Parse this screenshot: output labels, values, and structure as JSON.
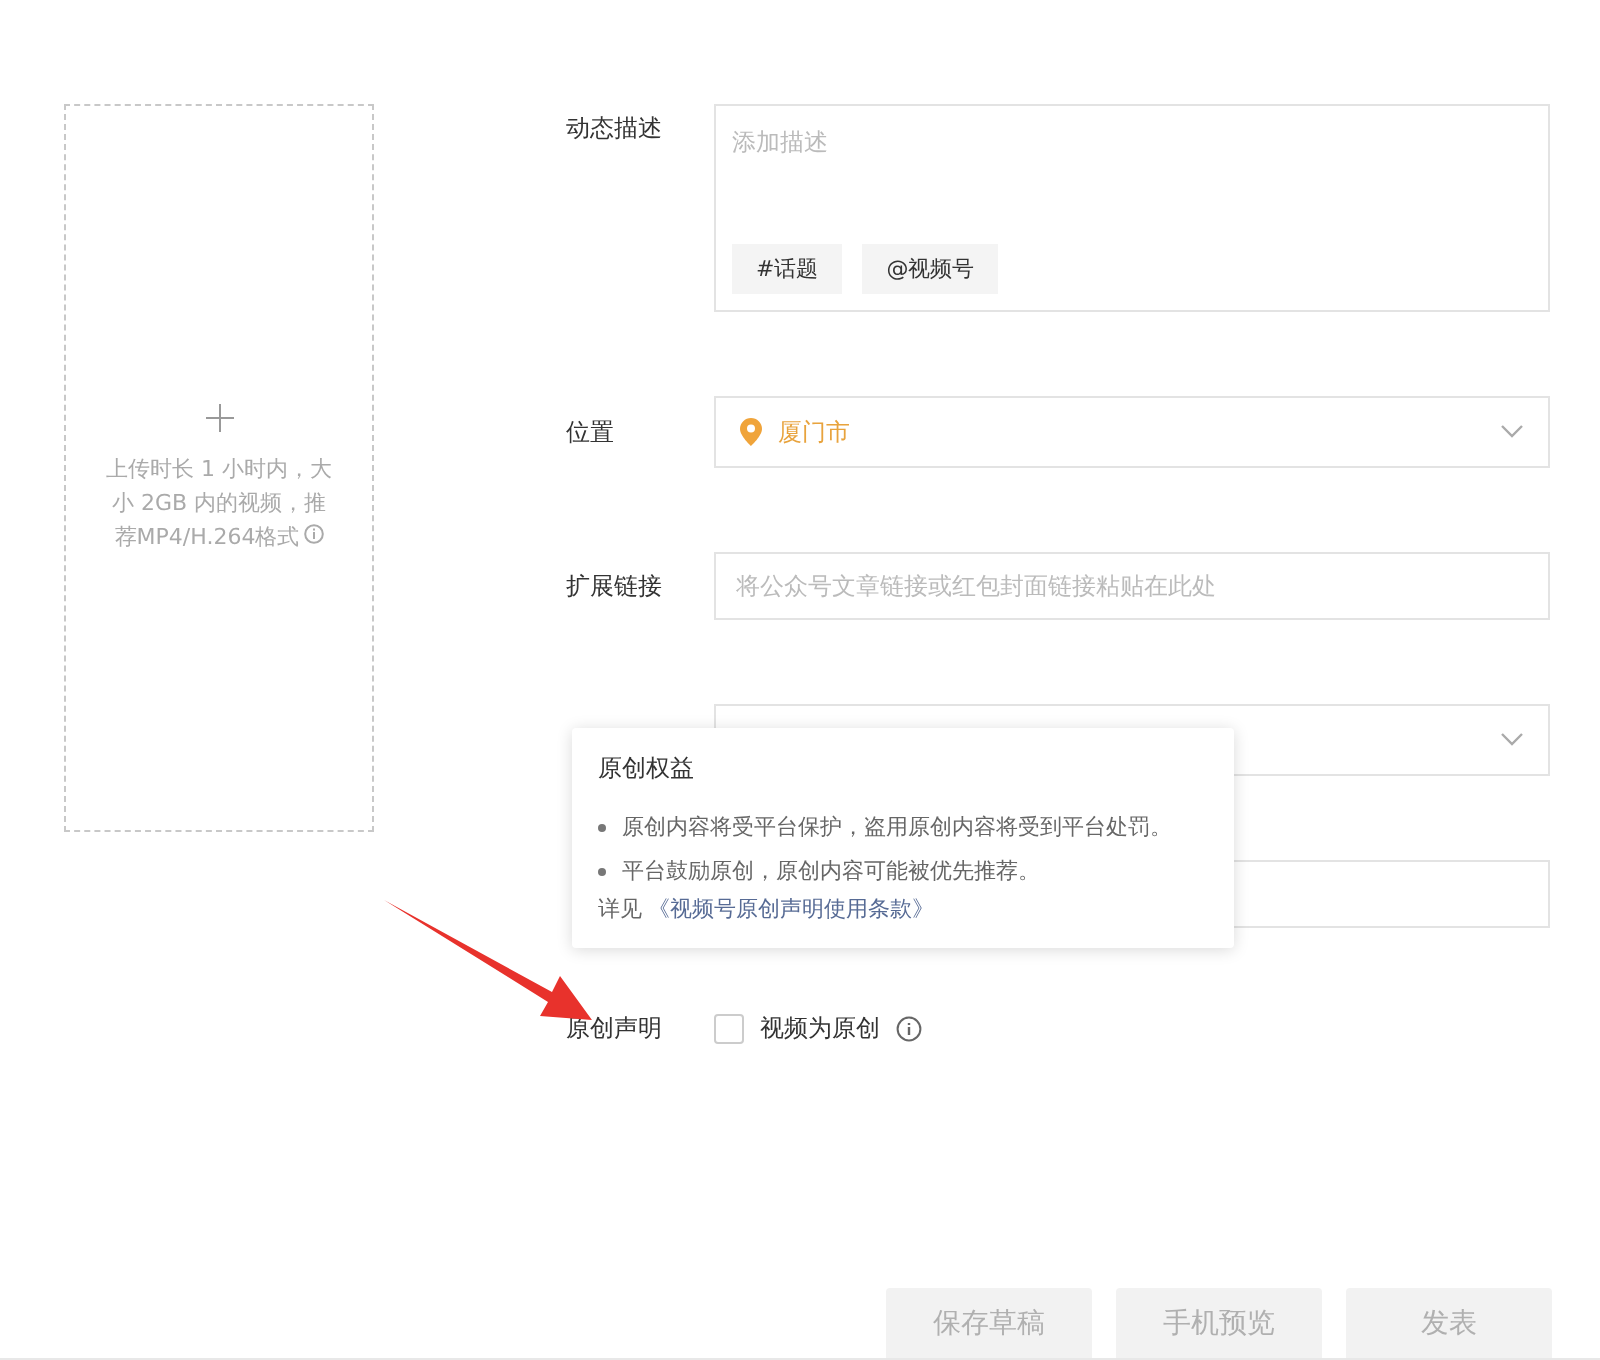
{
  "upload": {
    "hint": "上传时长 1 小时内，大小 2GB 内的视频，推荐MP4/H.264格式"
  },
  "fields": [
    {
      "kind": "textarea",
      "label": "动态描述",
      "placeholder": "添加描述",
      "chips": [
        "#话题",
        "@视频号"
      ]
    },
    {
      "kind": "select",
      "label": "位置",
      "value": "厦门市"
    },
    {
      "kind": "input",
      "label": "扩展链接",
      "placeholder": "将公众号文章链接或红包封面链接粘贴在此处"
    },
    {
      "kind": "select"
    },
    {
      "kind": "input"
    },
    {
      "kind": "checkbox",
      "label": "原创声明",
      "option": "视频为原创",
      "checked": false
    }
  ],
  "tooltip": {
    "title": "原创权益",
    "items": [
      "原创内容将受平台保护，盗用原创内容将受到平台处罚。",
      "平台鼓励原创，原创内容可能被优先推荐。"
    ],
    "prefix": "详见",
    "link": "《视频号原创声明使用条款》"
  },
  "buttons": [
    {
      "label": "保存草稿",
      "disabled": true
    },
    {
      "label": "手机预览",
      "disabled": true
    },
    {
      "label": "发表",
      "disabled": true
    }
  ]
}
